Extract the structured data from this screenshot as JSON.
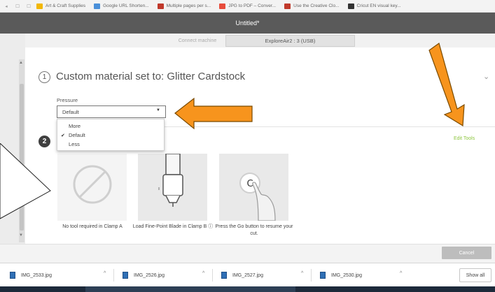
{
  "bookmarks": [
    {
      "label": "Art & Craft Supplies",
      "color": "#f2b705"
    },
    {
      "label": "Google URL Shorten...",
      "color": "#4a90d9"
    },
    {
      "label": "Multiple pages per s...",
      "color": "#c0392b"
    },
    {
      "label": "JPG to PDF – Conver...",
      "color": "#e74c3c"
    },
    {
      "label": "Use the Creative Clo...",
      "color": "#c0392b"
    },
    {
      "label": "Cricut EN visual key...",
      "color": "#333333"
    }
  ],
  "window": {
    "title": "Untitled*"
  },
  "machine": {
    "connect_label": "Connect machine",
    "selected": "ExploreAir2 : 3 (USB)"
  },
  "step1": {
    "number": "1",
    "heading": "Custom material set to: Glitter Cardstock"
  },
  "pressure": {
    "label": "Pressure",
    "selected": "Default",
    "options": [
      {
        "label": "More",
        "checked": false
      },
      {
        "label": "Default",
        "checked": true
      },
      {
        "label": "Less",
        "checked": false
      }
    ]
  },
  "step2": {
    "number": "2",
    "edit_tools": "Edit Tools"
  },
  "tools": [
    {
      "caption": "No tool required in Clamp A",
      "icon": "no-tool-icon"
    },
    {
      "caption": "Load Fine-Point Blade in Clamp B ⓘ",
      "icon": "fine-point-blade-icon"
    },
    {
      "caption": "Press the Go button to resume your cut.",
      "icon": "go-button-press-icon"
    }
  ],
  "footer": {
    "cancel": "Cancel"
  },
  "downloads": {
    "files": [
      "IMG_2533.jpg",
      "IMG_2526.jpg",
      "IMG_2527.jpg",
      "IMG_2530.jpg"
    ],
    "show_all": "Show all"
  },
  "colors": {
    "arrow": "#f7941d",
    "accent_green": "#8dc63f",
    "titlebar": "#5a5a5a"
  }
}
